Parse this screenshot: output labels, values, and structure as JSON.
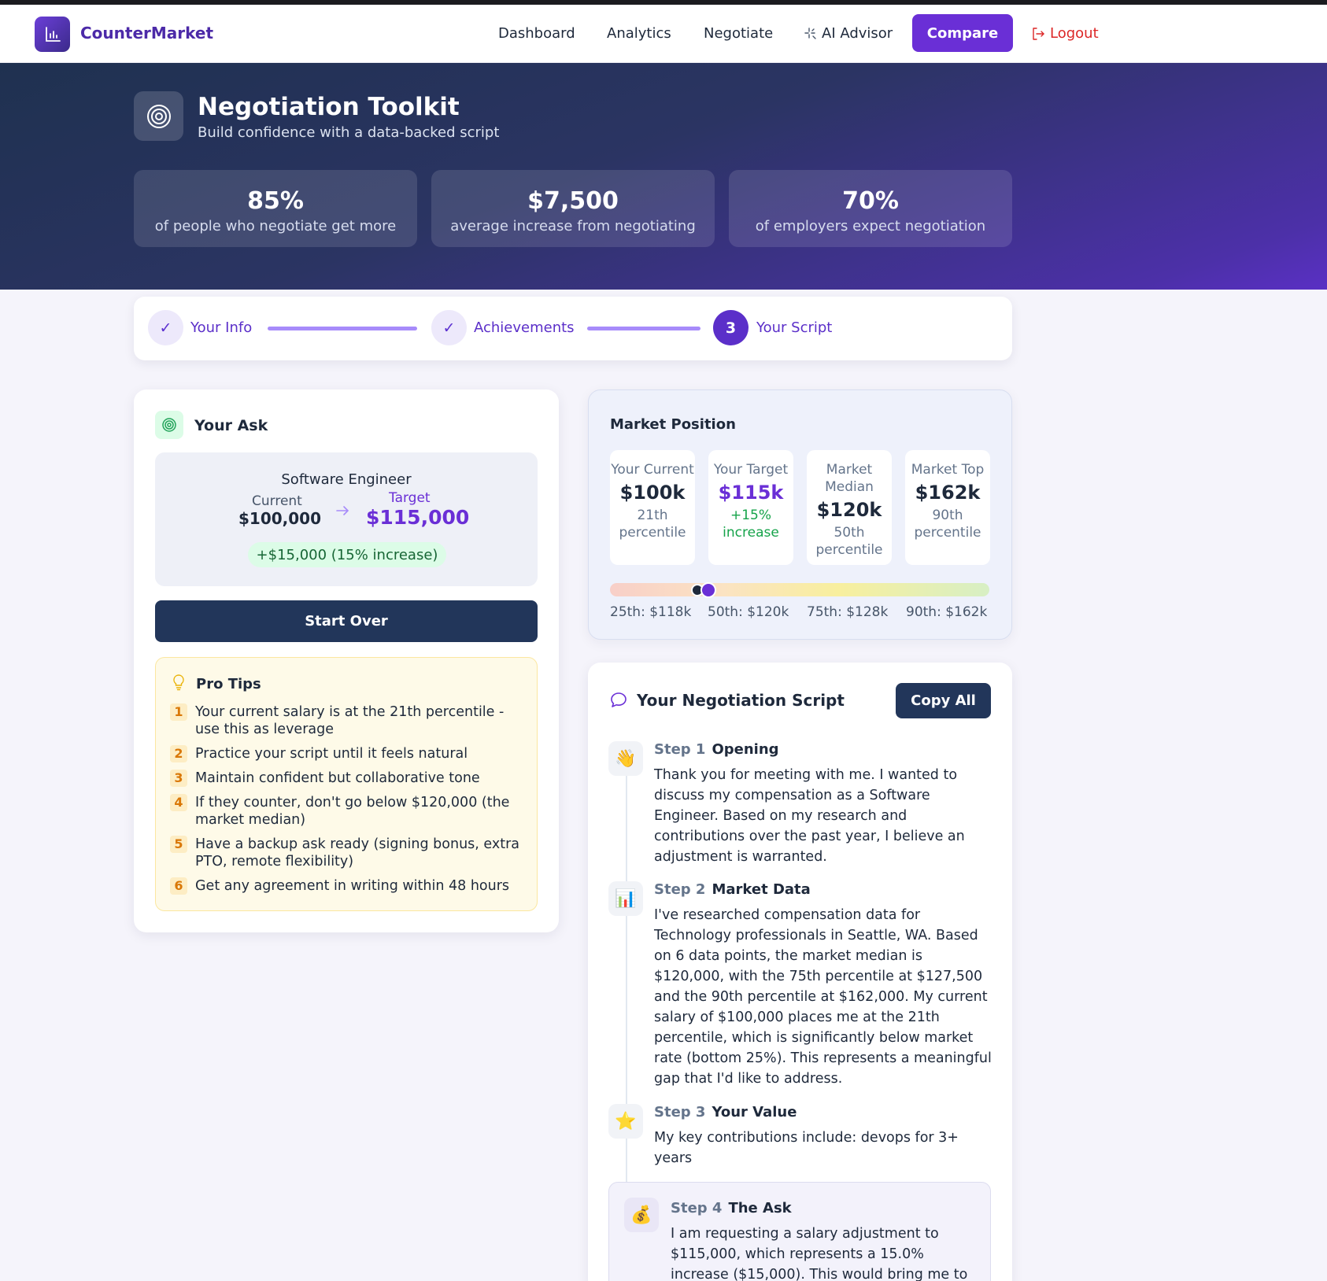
{
  "nav": {
    "brand": "CounterMarket",
    "links": [
      "Dashboard",
      "Analytics",
      "Negotiate",
      "AI Advisor"
    ],
    "compare": "Compare",
    "logout": "Logout",
    "icons": [
      "chart-icon",
      "sparkle-icon",
      "logout-icon"
    ]
  },
  "hero": {
    "title": "Negotiation Toolkit",
    "subtitle": "Build confidence with a data-backed script",
    "icon": "target-icon",
    "stats": [
      {
        "value": "85%",
        "label": "of people who negotiate get more"
      },
      {
        "value": "$7,500",
        "label": "average increase from negotiating"
      },
      {
        "value": "70%",
        "label": "of employers expect negotiation"
      }
    ]
  },
  "stepper": {
    "steps": [
      {
        "label": "Your Info",
        "state": "done",
        "marker": "✓"
      },
      {
        "label": "Achievements",
        "state": "done",
        "marker": "✓"
      },
      {
        "label": "Your Script",
        "state": "active",
        "marker": "3"
      }
    ]
  },
  "ask": {
    "title": "Your Ask",
    "role": "Software Engineer",
    "current_label": "Current",
    "current_value": "$100,000",
    "target_label": "Target",
    "target_value": "$115,000",
    "increase": "+$15,000 (15% increase)",
    "start_over": "Start Over",
    "tips_title": "Pro Tips",
    "tips": [
      "Your current salary is at the 21th percentile - use this as leverage",
      "Practice your script until it feels natural",
      "Maintain confident but collaborative tone",
      "If they counter, don't go below $120,000 (the market median)",
      "Have a backup ask ready (signing bonus, extra PTO, remote flexibility)",
      "Get any agreement in writing within 48 hours"
    ]
  },
  "market": {
    "title": "Market Position",
    "cards": [
      {
        "label": "Your Current",
        "value": "$100k",
        "sub": "21th percentile"
      },
      {
        "label": "Your Target",
        "value": "$115k",
        "sub": "+15% increase"
      },
      {
        "label": "Market Median",
        "value": "$120k",
        "sub": "50th percentile"
      },
      {
        "label": "Market Top",
        "value": "$162k",
        "sub": "90th percentile"
      }
    ],
    "percentiles": [
      "25th: $118k",
      "50th: $120k",
      "75th: $128k",
      "90th: $162k"
    ],
    "markers": {
      "current_fraction": 0.23,
      "target_fraction": 0.26
    },
    "colors": {
      "current": "#1e293b",
      "target": "#6a2fd6"
    }
  },
  "script": {
    "title": "Your Negotiation Script",
    "copy_all": "Copy All",
    "steps": [
      {
        "num": "Step 1",
        "name": "Opening",
        "icon": "👋",
        "text": "Thank you for meeting with me. I wanted to discuss my compensation as a Software Engineer. Based on my research and contributions over the past year, I believe an adjustment is warranted."
      },
      {
        "num": "Step 2",
        "name": "Market Data",
        "icon": "📊",
        "text": "I've researched compensation data for Technology professionals in Seattle, WA. Based on 6 data points, the market median is $120,000, with the 75th percentile at $127,500 and the 90th percentile at $162,000. My current salary of $100,000 places me at the 21th percentile, which is significantly below market rate (bottom 25%). This represents a meaningful gap that I'd like to address."
      },
      {
        "num": "Step 3",
        "name": "Your Value",
        "icon": "⭐",
        "text": "My key contributions include: devops for 3+ years"
      },
      {
        "num": "Step 4",
        "name": "The Ask",
        "icon": "💰",
        "text": "I am requesting a salary adjustment to $115,000, which represents a 15.0% increase ($15,000). This would bring me to"
      }
    ]
  }
}
